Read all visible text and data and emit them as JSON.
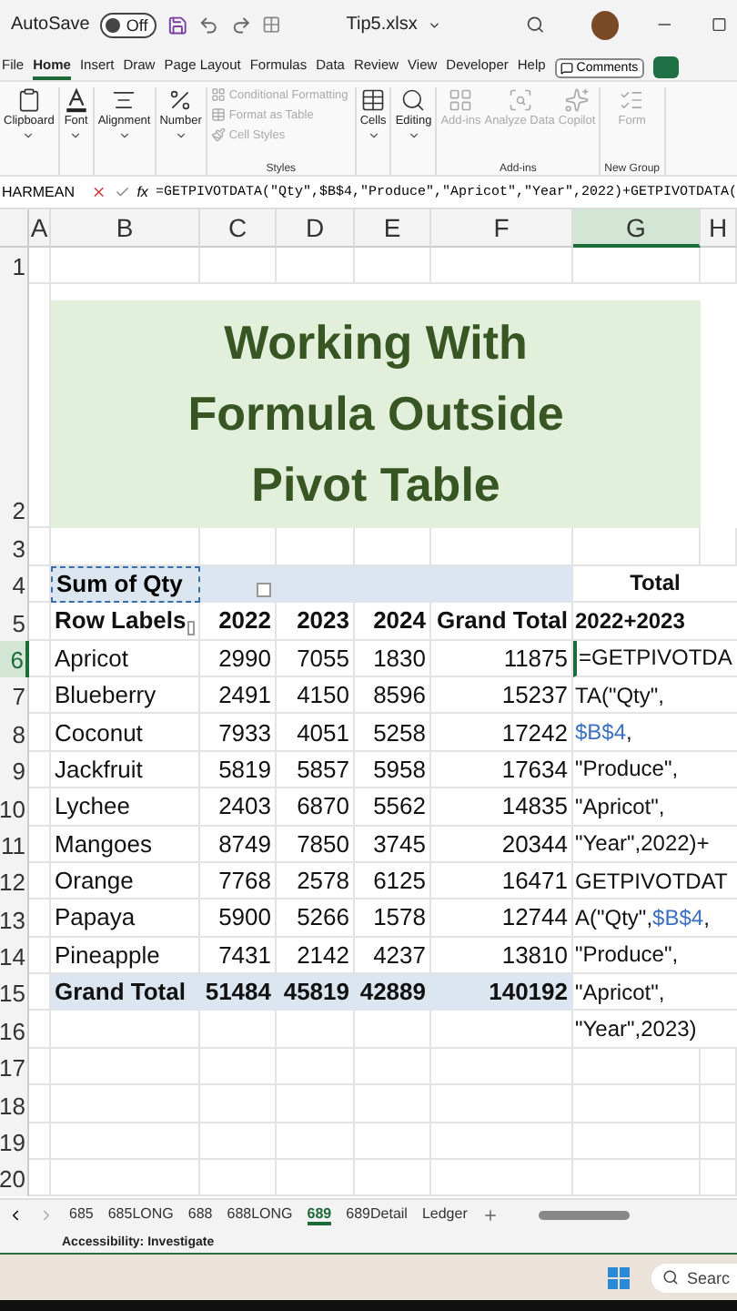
{
  "title_bar": {
    "autosave_label": "AutoSave",
    "autosave_on": false,
    "toggle_text": "Off",
    "file_name": "Tip5.xlsx"
  },
  "menu_tabs": [
    {
      "label": "File",
      "selected": false
    },
    {
      "label": "Home",
      "selected": true
    },
    {
      "label": "Insert",
      "selected": false
    },
    {
      "label": "Draw",
      "selected": false
    },
    {
      "label": "Page Layout",
      "selected": false
    },
    {
      "label": "Formulas",
      "selected": false
    },
    {
      "label": "Data",
      "selected": false
    },
    {
      "label": "Review",
      "selected": false
    },
    {
      "label": "View",
      "selected": false
    },
    {
      "label": "Developer",
      "selected": false
    },
    {
      "label": "Help",
      "selected": false
    }
  ],
  "comments_button": "Comments",
  "ribbon_groups": [
    {
      "kind": "buttons",
      "buttons": [
        {
          "label": "Clipboard",
          "disabled": false,
          "menu": true
        }
      ]
    },
    {
      "kind": "buttons",
      "buttons": [
        {
          "label": "Font",
          "disabled": false,
          "menu": true
        }
      ]
    },
    {
      "kind": "buttons",
      "buttons": [
        {
          "label": "Alignment",
          "disabled": false,
          "menu": true
        }
      ]
    },
    {
      "kind": "buttons",
      "buttons": [
        {
          "label": "Number",
          "disabled": false,
          "menu": true
        }
      ]
    },
    {
      "kind": "list",
      "caption": "Styles",
      "items": [
        {
          "label": "Conditional Formatting",
          "disabled": true
        },
        {
          "label": "Format as Table",
          "disabled": true
        },
        {
          "label": "Cell Styles",
          "disabled": true
        }
      ]
    },
    {
      "kind": "buttons",
      "buttons": [
        {
          "label": "Cells",
          "disabled": false,
          "menu": true
        }
      ]
    },
    {
      "kind": "buttons",
      "buttons": [
        {
          "label": "Editing",
          "disabled": false,
          "menu": true
        }
      ]
    },
    {
      "kind": "buttons",
      "caption": "Add-ins",
      "buttons": [
        {
          "label": "Add-ins",
          "disabled": true,
          "menu": false
        },
        {
          "label": "Analyze Data",
          "disabled": true,
          "menu": false
        },
        {
          "label": "Copilot",
          "disabled": true,
          "menu": false
        }
      ]
    },
    {
      "kind": "buttons",
      "caption": "New Group",
      "buttons": [
        {
          "label": "Form",
          "disabled": true,
          "menu": false
        }
      ]
    }
  ],
  "formula_bar": {
    "name_box": "HARMEAN",
    "function_label": "fx",
    "formula": "=GETPIVOTDATA(\"Qty\",$B$4,\"Produce\",\"Apricot\",\"Year\",2022)+GETPIVOTDATA("
  },
  "columns": [
    {
      "label": "A",
      "selected": false
    },
    {
      "label": "B",
      "selected": false
    },
    {
      "label": "C",
      "selected": false
    },
    {
      "label": "D",
      "selected": false
    },
    {
      "label": "E",
      "selected": false
    },
    {
      "label": "F",
      "selected": false
    },
    {
      "label": "G",
      "selected": true
    },
    {
      "label": "H",
      "selected": false
    }
  ],
  "rows": [
    {
      "number": "1",
      "kind": "blank",
      "selected": false
    },
    {
      "number": "2",
      "kind": "title",
      "selected": false,
      "lines": [
        "Working With",
        "Formula Outside",
        "Pivot Table"
      ]
    },
    {
      "number": "3",
      "kind": "blank",
      "selected": false
    },
    {
      "number": "4",
      "kind": "pivot_header",
      "selected": false,
      "cells": [
        "Sum of Qty",
        "",
        "",
        "",
        ""
      ],
      "g": [
        {
          "text": "Total",
          "ref": false
        }
      ]
    },
    {
      "number": "5",
      "kind": "pivot_columns",
      "selected": false,
      "cells": [
        "Row Labels",
        "2022",
        "2023",
        "2024",
        "Grand Total"
      ],
      "g": [
        {
          "text": "2022+2023",
          "ref": false
        }
      ]
    },
    {
      "number": "6",
      "kind": "data",
      "selected": true,
      "cells": [
        "Apricot",
        "2990",
        "7055",
        "1830",
        "11875"
      ],
      "g": [
        {
          "text": "=GETPIVOTDA",
          "ref": false
        }
      ]
    },
    {
      "number": "7",
      "kind": "data",
      "selected": false,
      "cells": [
        "Blueberry",
        "2491",
        "4150",
        "8596",
        "15237"
      ],
      "g": [
        {
          "text": "TA(\"Qty\",",
          "ref": false
        }
      ]
    },
    {
      "number": "8",
      "kind": "data",
      "selected": false,
      "cells": [
        "Coconut",
        "7933",
        "4051",
        "5258",
        "17242"
      ],
      "g": [
        {
          "text": "$B$4",
          "ref": true
        },
        {
          "text": ",",
          "ref": false
        }
      ]
    },
    {
      "number": "9",
      "kind": "data",
      "selected": false,
      "cells": [
        "Jackfruit",
        "5819",
        "5857",
        "5958",
        "17634"
      ],
      "g": [
        {
          "text": "\"Produce\",",
          "ref": false
        }
      ]
    },
    {
      "number": "10",
      "kind": "data",
      "selected": false,
      "cells": [
        "Lychee",
        "2403",
        "6870",
        "5562",
        "14835"
      ],
      "g": [
        {
          "text": "\"Apricot\",",
          "ref": false
        }
      ]
    },
    {
      "number": "11",
      "kind": "data",
      "selected": false,
      "cells": [
        "Mangoes",
        "8749",
        "7850",
        "3745",
        "20344"
      ],
      "g": [
        {
          "text": "\"Year\",2022)+",
          "ref": false
        }
      ]
    },
    {
      "number": "12",
      "kind": "data",
      "selected": false,
      "cells": [
        "Orange",
        "7768",
        "2578",
        "6125",
        "16471"
      ],
      "g": [
        {
          "text": "GETPIVOTDAT",
          "ref": false
        }
      ]
    },
    {
      "number": "13",
      "kind": "data",
      "selected": false,
      "cells": [
        "Papaya",
        "5900",
        "5266",
        "1578",
        "12744"
      ],
      "g": [
        {
          "text": "A(\"Qty\",",
          "ref": false
        },
        {
          "text": "$B$4",
          "ref": true
        },
        {
          "text": ",",
          "ref": false
        }
      ]
    },
    {
      "number": "14",
      "kind": "data",
      "selected": false,
      "cells": [
        "Pineapple",
        "7431",
        "2142",
        "4237",
        "13810"
      ],
      "g": [
        {
          "text": "\"Produce\",",
          "ref": false
        }
      ]
    },
    {
      "number": "15",
      "kind": "total",
      "selected": false,
      "cells": [
        "Grand Total",
        "51484",
        "45819",
        "42889",
        "140192"
      ],
      "g": [
        {
          "text": "\"Apricot\",",
          "ref": false
        }
      ]
    },
    {
      "number": "16",
      "kind": "blank",
      "selected": false,
      "g": [
        {
          "text": "\"Year\",2023)",
          "ref": false
        }
      ]
    },
    {
      "number": "17",
      "kind": "blank",
      "selected": false
    },
    {
      "number": "18",
      "kind": "blank",
      "selected": false
    },
    {
      "number": "19",
      "kind": "blank",
      "selected": false
    },
    {
      "number": "20",
      "kind": "blank",
      "selected": false
    }
  ],
  "sheet_tabs": [
    {
      "label": "685",
      "selected": false
    },
    {
      "label": "685LONG",
      "selected": false
    },
    {
      "label": "688",
      "selected": false
    },
    {
      "label": "688LONG",
      "selected": false
    },
    {
      "label": "689",
      "selected": true
    },
    {
      "label": "689Detail",
      "selected": false
    },
    {
      "label": "Ledger",
      "selected": false
    }
  ],
  "status_bar": {
    "accessibility": "Accessibility: Investigate"
  },
  "taskbar": {
    "search": "Searc"
  }
}
